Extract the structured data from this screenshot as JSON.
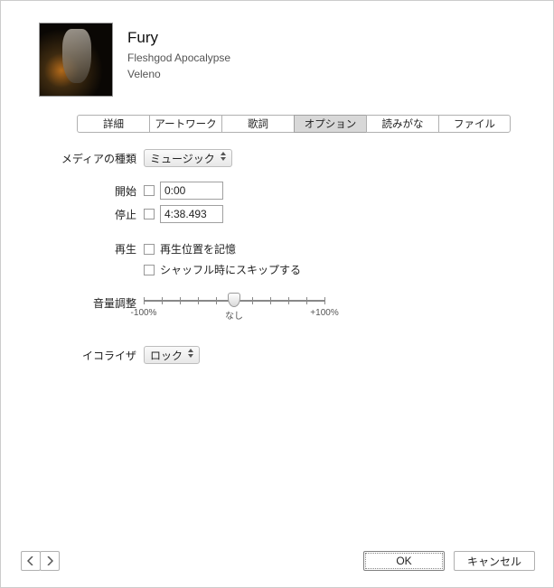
{
  "track": {
    "title": "Fury",
    "artist": "Fleshgod Apocalypse",
    "album": "Veleno"
  },
  "tabs": {
    "detail": "詳細",
    "artwork": "アートワーク",
    "lyrics": "歌詞",
    "options": "オプション",
    "reading": "読みがな",
    "file": "ファイル"
  },
  "labels": {
    "media_type": "メディアの種類",
    "start": "開始",
    "stop": "停止",
    "playback": "再生",
    "volume": "音量調整",
    "equalizer": "イコライザ"
  },
  "values": {
    "media_type_select": "ミュージック",
    "start_time": "0:00",
    "stop_time": "4:38.493",
    "remember_position": "再生位置を記憶",
    "skip_shuffle": "シャッフル時にスキップする",
    "equalizer_select": "ロック",
    "slider_left": "-100%",
    "slider_center": "なし",
    "slider_right": "+100%"
  },
  "buttons": {
    "ok": "OK",
    "cancel": "キャンセル"
  }
}
